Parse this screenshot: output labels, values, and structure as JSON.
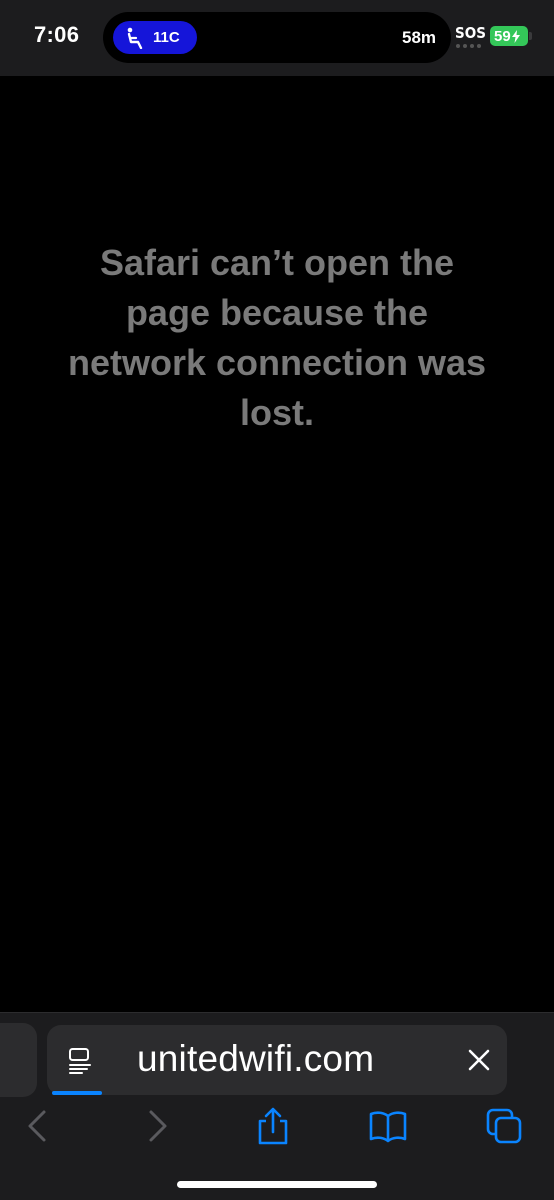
{
  "status_bar": {
    "time": "7:06",
    "seat": "11C",
    "duration": "58m",
    "sos": "SOS",
    "battery": "59",
    "seat_icon": "seat-recline-icon",
    "battery_color": "#34c759",
    "pill_color": "#1515d9"
  },
  "page": {
    "error_message": "Safari can’t open the page because the network connection was lost."
  },
  "toolbar": {
    "url": "unitedwifi.com",
    "accent": "#0a84ff",
    "icons": {
      "reader": "reader-mode-icon",
      "close": "close-icon",
      "back": "chevron-left-icon",
      "forward": "chevron-right-icon",
      "share": "share-icon",
      "bookmarks": "book-icon",
      "tabs": "tabs-icon"
    }
  }
}
